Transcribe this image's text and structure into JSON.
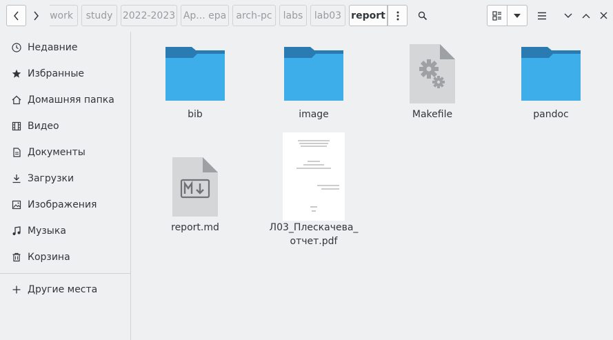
{
  "header": {
    "back_icon": "chevron-left-icon",
    "forward_icon": "chevron-right-icon",
    "breadcrumbs": [
      "work",
      "study",
      "2022-2023",
      "Ар... ера",
      "arch-pc",
      "labs",
      "lab03",
      "report"
    ],
    "path_menu_icon": "vertical-dots-icon",
    "search_icon": "search-icon",
    "view_icon": "grid-list-view-icon",
    "view_dropdown_icon": "triangle-down-icon",
    "menu_icon": "hamburger-icon",
    "window_minimize_icon": "chevron-down-icon",
    "window_maximize_icon": "chevron-up-icon",
    "window_close_icon": "close-icon"
  },
  "sidebar": {
    "items": [
      {
        "label": "Недавние",
        "icon": "clock-icon"
      },
      {
        "label": "Избранные",
        "icon": "star-icon"
      },
      {
        "label": "Домашняя папка",
        "icon": "home-icon"
      },
      {
        "label": "Видео",
        "icon": "film-icon"
      },
      {
        "label": "Документы",
        "icon": "document-icon"
      },
      {
        "label": "Загрузки",
        "icon": "download-icon"
      },
      {
        "label": "Изображения",
        "icon": "image-icon"
      },
      {
        "label": "Музыка",
        "icon": "music-icon"
      },
      {
        "label": "Корзина",
        "icon": "trash-icon"
      }
    ],
    "other_places": {
      "label": "Другие места",
      "icon": "plus-icon"
    }
  },
  "files": [
    {
      "name": "bib",
      "type": "folder"
    },
    {
      "name": "image",
      "type": "folder"
    },
    {
      "name": "Makefile",
      "type": "makefile"
    },
    {
      "name": "pandoc",
      "type": "folder"
    },
    {
      "name": "report.md",
      "type": "markdown"
    },
    {
      "name_line1": "Л03_Плескачева_",
      "name_line2": "отчет.pdf",
      "type": "pdf"
    }
  ],
  "colors": {
    "folder_front": "#3daee9",
    "folder_back": "#2b7bb3",
    "doc_gray": "#d4d6d8",
    "doc_fold": "#9da1a4"
  }
}
